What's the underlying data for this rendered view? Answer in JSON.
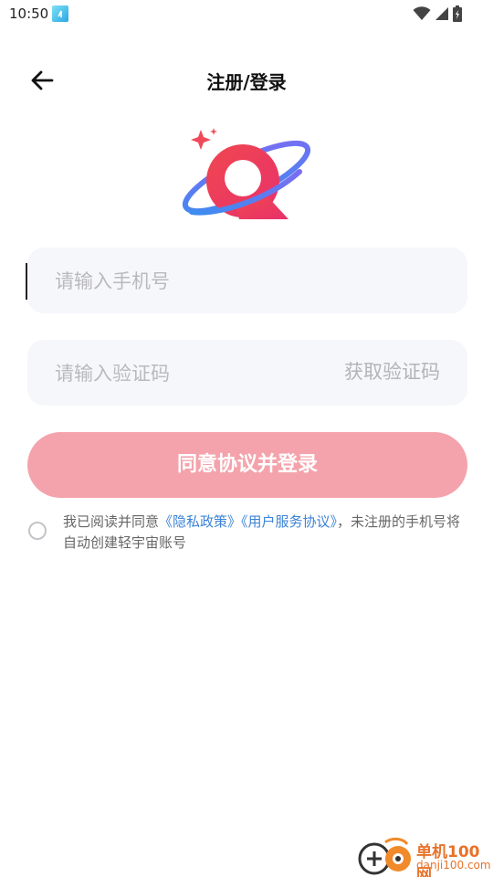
{
  "status_bar": {
    "time": "10:50",
    "icons": [
      "app-notification-icon",
      "wifi-icon",
      "signal-icon",
      "battery-charging-icon"
    ]
  },
  "header": {
    "title": "注册/登录",
    "back_icon": "arrow-left-icon"
  },
  "phone_field": {
    "placeholder": "请输入手机号",
    "value": ""
  },
  "code_field": {
    "placeholder": "请输入验证码",
    "value": "",
    "get_code_label": "获取验证码"
  },
  "submit": {
    "label": "同意协议并登录"
  },
  "agreement": {
    "checked": false,
    "prefix": "我已阅读并同意",
    "privacy_link": "《隐私政策》",
    "terms_link": "《用户服务协议》",
    "suffix": "，未注册的手机号将自动创建轻宇宙账号"
  },
  "watermark": {
    "cn": "单机100网",
    "en": "danji100.com"
  },
  "colors": {
    "accent_pink": "#f4a3ac",
    "link_blue": "#3b82d6",
    "field_bg": "#f6f7fb"
  }
}
